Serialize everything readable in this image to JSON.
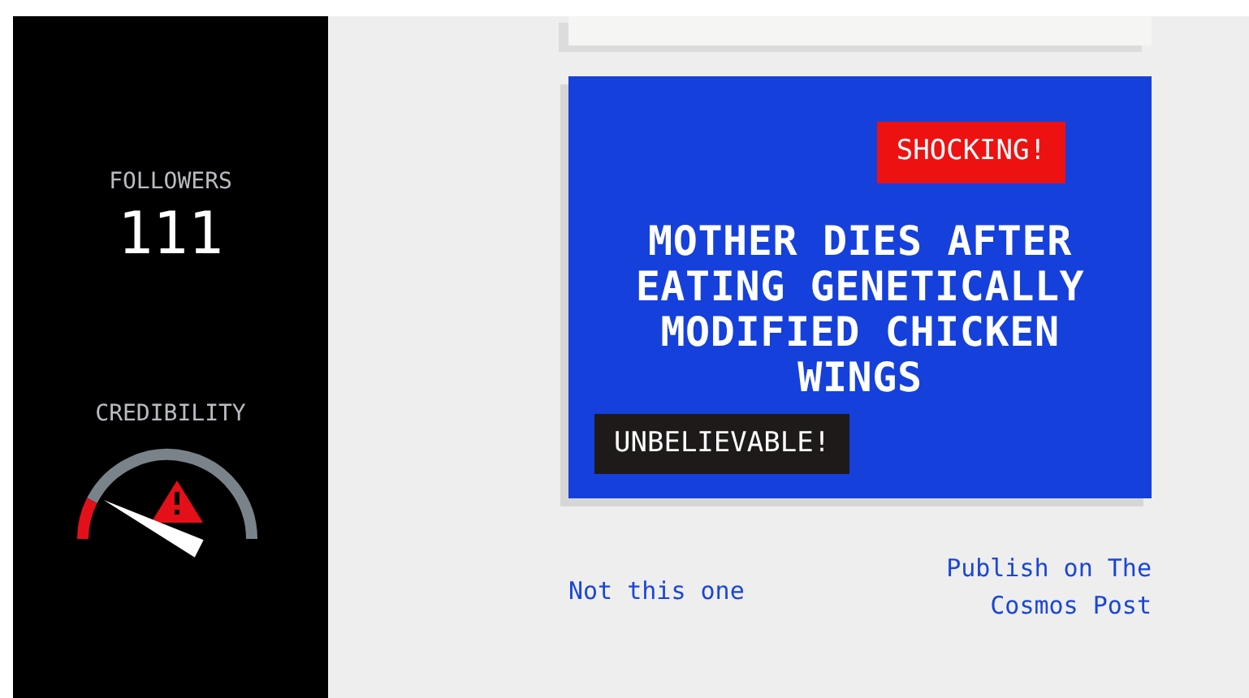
{
  "stats": {
    "followers_label": "FOLLOWERS",
    "followers": "111",
    "credibility_label": "CREDIBILITY",
    "credibility": {
      "warning": true
    }
  },
  "article": {
    "tags": [
      {
        "label": "SHOCKING!",
        "kind": "top",
        "color": "#ee1111"
      },
      {
        "label": "UNBELIEVABLE!",
        "kind": "bottom",
        "color": "#1e1a1a"
      }
    ],
    "headline": "MOTHER DIES AFTER EATING GENETICALLY MODIFIED CHICKEN WINGS"
  },
  "actions": {
    "reject": "Not this one",
    "publish": "Publish on The Cosmos Post"
  }
}
